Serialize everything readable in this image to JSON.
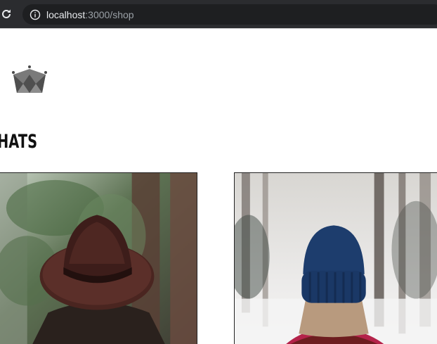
{
  "browser": {
    "url_host": "localhost",
    "url_path": ":3000/shop"
  },
  "page": {
    "logo_icon": "crown-icon",
    "section_title": "HATS"
  },
  "products": [
    {
      "image": "brown-fedora-hat-photo"
    },
    {
      "image": "blue-beanie-photo"
    }
  ]
}
